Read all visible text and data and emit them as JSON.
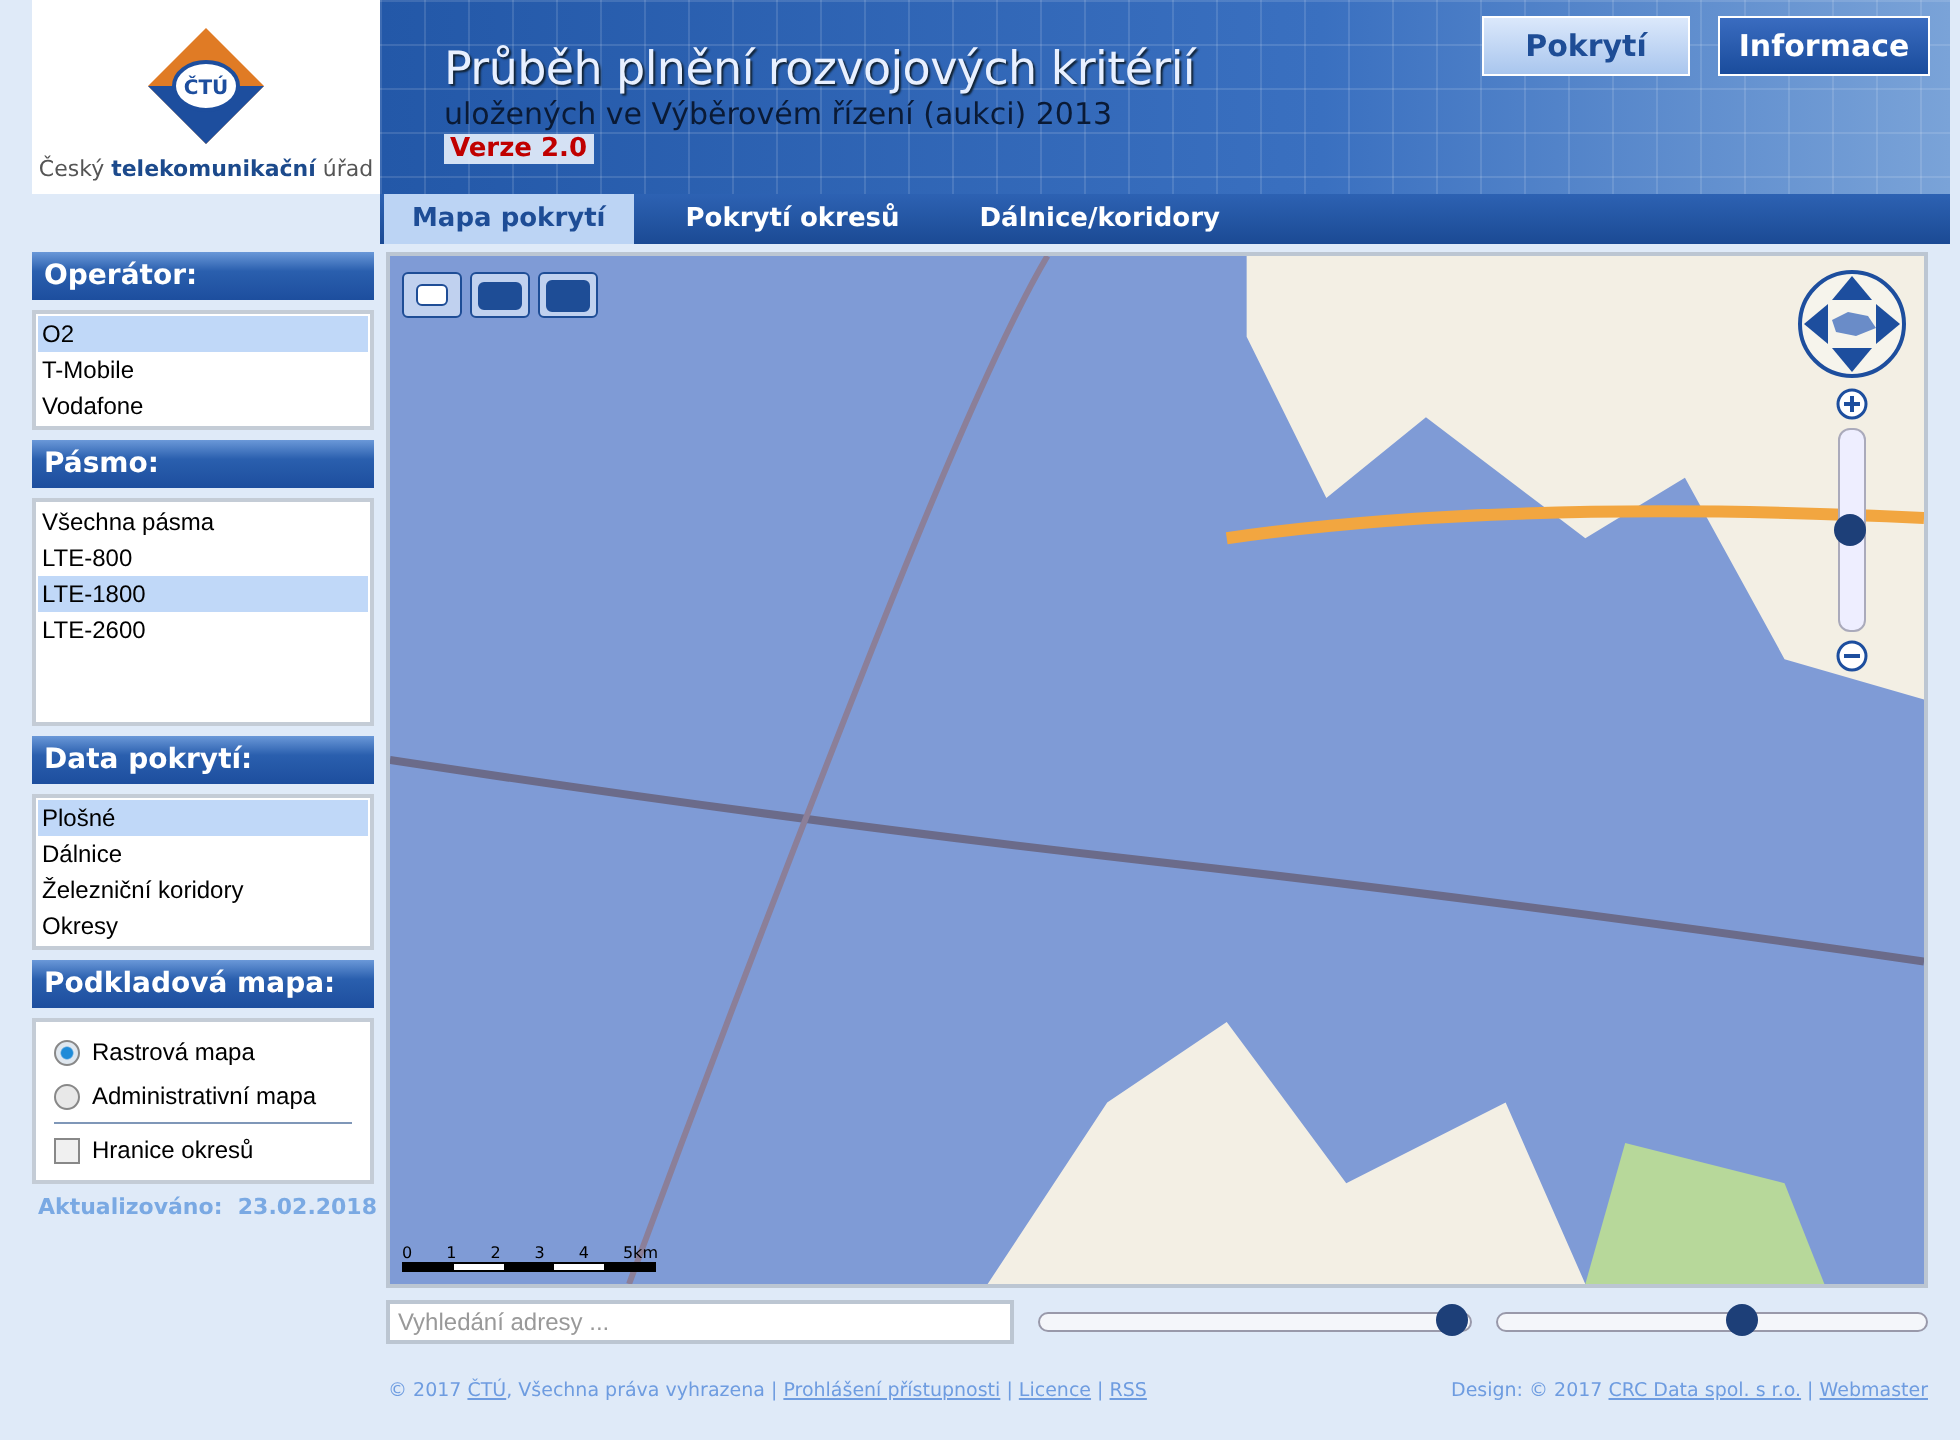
{
  "logo": {
    "abbr": "ČTÚ",
    "caption": "Český **telekomunikační** úřad"
  },
  "header": {
    "title": "Průběh plnění rozvojových kritérií",
    "subtitle": "uložených ve Výběrovém řízení (aukci) 2013",
    "version": "Verze 2.0"
  },
  "top_buttons": [
    {
      "label": "Pokrytí",
      "selected": true
    },
    {
      "label": "Informace",
      "selected": false
    }
  ],
  "tabs": [
    {
      "label": "Mapa pokrytí",
      "selected": true
    },
    {
      "label": "Pokrytí okresů",
      "selected": false
    },
    {
      "label": "Dálnice/koridory",
      "selected": false
    }
  ],
  "panels": [
    {
      "title": "Operátor:",
      "kind": "list",
      "items": [
        {
          "label": "O2",
          "selected": true
        },
        {
          "label": "T-Mobile",
          "selected": false
        },
        {
          "label": "Vodafone",
          "selected": false
        }
      ]
    },
    {
      "title": "Pásmo:",
      "kind": "list",
      "items": [
        {
          "label": "Všechna pásma",
          "selected": false
        },
        {
          "label": "LTE-800",
          "selected": false
        },
        {
          "label": "LTE-1800",
          "selected": true
        },
        {
          "label": "LTE-2600",
          "selected": false
        }
      ]
    },
    {
      "title": "Data pokrytí:",
      "kind": "list",
      "items": [
        {
          "label": "Plošné",
          "selected": true
        },
        {
          "label": "Dálnice",
          "selected": false
        },
        {
          "label": "Železniční koridory",
          "selected": false
        },
        {
          "label": "Okresy",
          "selected": false
        }
      ]
    },
    {
      "title": "Podkladová mapa:",
      "kind": "options",
      "radios": [
        {
          "label": "Rastrová mapa",
          "selected": true
        },
        {
          "label": "Administrativní mapa",
          "selected": false
        }
      ],
      "checkbox": {
        "label": "Hranice okresů",
        "checked": false
      }
    }
  ],
  "updated": {
    "label": "Aktualizováno:",
    "date": "23.02.2018"
  },
  "map": {
    "view_buttons": [
      {
        "selected": false
      },
      {
        "selected": false
      },
      {
        "selected": false
      }
    ],
    "zoom": {
      "level": 0.5
    },
    "scale": [
      "0",
      "1",
      "2",
      "3",
      "4",
      "5km"
    ]
  },
  "search": {
    "placeholder": "Vyhledání adresy ..."
  },
  "sliders": [
    {
      "level": 0.96
    },
    {
      "level": 0.57
    }
  ],
  "footer": {
    "left": [
      {
        "kind": "text",
        "text": "© 2017 "
      },
      {
        "kind": "link",
        "text": "ČTÚ"
      },
      {
        "kind": "text",
        "text": ", Všechna práva vyhrazena | "
      },
      {
        "kind": "link",
        "text": "Prohlášení přístupnosti"
      },
      {
        "kind": "text",
        "text": " | "
      },
      {
        "kind": "link",
        "text": "Licence"
      },
      {
        "kind": "text",
        "text": " | "
      },
      {
        "kind": "link",
        "text": "RSS"
      }
    ],
    "right": [
      {
        "kind": "text",
        "text": "Design: © 2017 "
      },
      {
        "kind": "link",
        "text": "CRC Data spol. s r.o."
      },
      {
        "kind": "text",
        "text": " | "
      },
      {
        "kind": "link",
        "text": "Webmaster"
      }
    ]
  }
}
